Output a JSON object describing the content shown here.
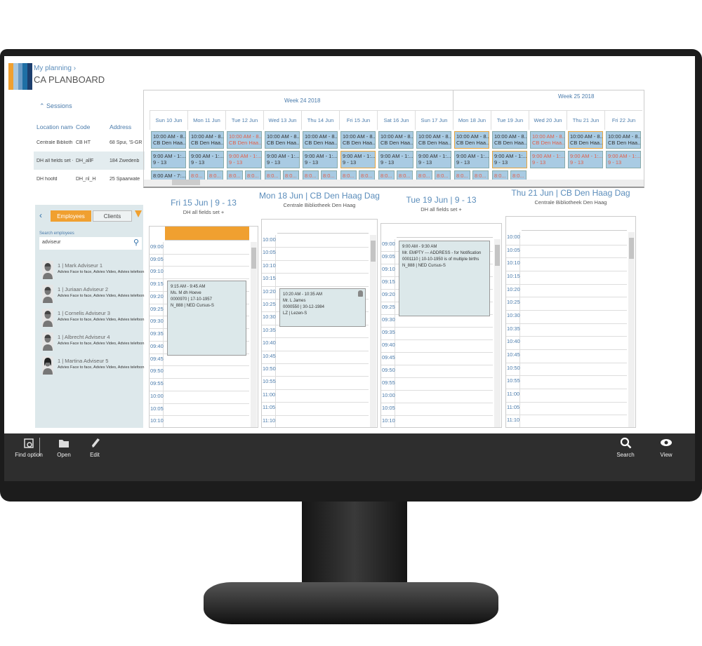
{
  "header": {
    "breadcrumb": "My planning",
    "title": "CA PLANBOARD",
    "logo_colors": [
      "#f0a030",
      "#a9c7de",
      "#6a9bc6",
      "#1f6fa5",
      "#1d3f6e"
    ]
  },
  "sessions": {
    "label": "Sessions",
    "columns": [
      "Location name",
      "Code",
      "Address"
    ],
    "rows": [
      [
        "Centrale Biblioth...",
        "CB HT",
        "68 Spui, 'S-GR"
      ],
      [
        "DH all fields set +",
        "DH_allF",
        "184 Zwedenb"
      ],
      [
        "DH hoofd",
        "DH_nl_H",
        "25 Spaarwate"
      ]
    ]
  },
  "planboard": {
    "weeks": [
      "Week 24 2018",
      "Week 25 2018"
    ],
    "days": [
      {
        "label": "Sun 10 Jun",
        "r1": {
          "t": [
            "10:00 AM - 8...",
            "CB Den Haa..."
          ]
        },
        "r2": {
          "t": [
            "9:00 AM - 1:...",
            "9 - 13"
          ]
        },
        "r3": {
          "single": [
            "8:00 AM - 7:...",
            "NED | Cursus..."
          ]
        }
      },
      {
        "label": "Mon 11 Jun",
        "r1": {
          "t": [
            "10:00 AM - 8...",
            "CB Den Haa..."
          ]
        },
        "r2": {
          "t": [
            "9:00 AM - 1:...",
            "9 - 13"
          ]
        },
        "r3": {
          "pair": [
            "8:0...",
            "NE..."
          ]
        }
      },
      {
        "label": "Tue 12 Jun",
        "r1": {
          "t": [
            "10:00 AM - 8...",
            "CB Den Haa..."
          ],
          "red": true
        },
        "r2": {
          "t": [
            "9:00 AM - 1:...",
            "9 - 13"
          ],
          "red": true
        },
        "r3": {
          "pair": [
            "8:0...",
            "NE..."
          ]
        }
      },
      {
        "label": "Wed 13 Jun",
        "r1": {
          "t": [
            "10:00 AM - 8...",
            "CB Den Haa..."
          ]
        },
        "r2": {
          "t": [
            "9:00 AM - 1:...",
            "9 - 13"
          ]
        },
        "r3": {
          "pair": [
            "8:0...",
            "NE..."
          ]
        }
      },
      {
        "label": "Thu 14 Jun",
        "r1": {
          "t": [
            "10:00 AM - 8...",
            "CB Den Haa..."
          ]
        },
        "r2": {
          "t": [
            "9:00 AM - 1:...",
            "9 - 13"
          ]
        },
        "r3": {
          "pair": [
            "8:0...",
            "NE..."
          ]
        }
      },
      {
        "label": "Fri 15 Jun",
        "r1": {
          "t": [
            "10:00 AM - 8...",
            "CB Den Haa..."
          ]
        },
        "r2": {
          "t": [
            "9:00 AM - 1:...",
            "9 - 13"
          ],
          "sel": true
        },
        "r3": {
          "pair": [
            "8:0...",
            "NE..."
          ]
        }
      },
      {
        "label": "Sat 16 Jun",
        "r1": {
          "t": [
            "10:00 AM - 8...",
            "CB Den Haa..."
          ]
        },
        "r2": {
          "t": [
            "9:00 AM - 1:...",
            "9 - 13"
          ]
        },
        "r3": {
          "pair": [
            "8:0...",
            "NE..."
          ]
        }
      },
      {
        "label": "Sun 17 Jun",
        "r1": {
          "t": [
            "10:00 AM - 8...",
            "CB Den Haa..."
          ]
        },
        "r2": {
          "t": [
            "9:00 AM - 1:...",
            "9 - 13"
          ]
        },
        "r3": {
          "pair": [
            "8:0...",
            "NE..."
          ]
        }
      },
      {
        "label": "Mon 18 Jun",
        "r1": {
          "t": [
            "10:00 AM - 8...",
            "CB Den Haa..."
          ],
          "sel": true
        },
        "r2": {
          "t": [
            "9:00 AM - 1:...",
            "9 - 13"
          ]
        },
        "r3": {
          "pair": [
            "8:0...",
            "NE..."
          ]
        }
      },
      {
        "label": "Tue 19 Jun",
        "r1": {
          "t": [
            "10:00 AM - 8...",
            "CB Den Haa..."
          ]
        },
        "r2": {
          "t": [
            "9:00 AM - 1:...",
            "9 - 13"
          ],
          "sel": true
        },
        "r3": {
          "pair": [
            "8:0...",
            "NE..."
          ]
        }
      },
      {
        "label": "Wed 20 Jun",
        "r1": {
          "t": [
            "10:00 AM - 8...",
            "CB Den Haa..."
          ],
          "red": true
        },
        "r2": {
          "t": [
            "9:00 AM - 1:...",
            "9 - 13"
          ],
          "red": true
        }
      },
      {
        "label": "Thu 21 Jun",
        "r1": {
          "t": [
            "10:00 AM - 8...",
            "CB Den Haa..."
          ],
          "sel": true
        },
        "r2": {
          "t": [
            "9:00 AM - 1:...",
            "9 - 13"
          ],
          "red": true
        }
      },
      {
        "label": "Fri 22 Jun",
        "r1": {
          "t": [
            "10:00 AM - 8...",
            "CB Den Haa..."
          ]
        },
        "r2": {
          "t": [
            "9:00 AM - 1:...",
            "9 - 13"
          ],
          "red": true
        }
      }
    ]
  },
  "panel": {
    "tabs": [
      "Employees",
      "Clients"
    ],
    "active_tab": "Employees",
    "search_label": "Search employees",
    "search_value": "adviseur",
    "employees": [
      {
        "name": "1 | Mark Adviseur 1",
        "skills": "Advies Face to face, Advies Video, Advies telefoon",
        "gender": "m"
      },
      {
        "name": "1 | Juriaan Adviseur 2",
        "skills": "Advies Face to face, Advies Video, Advies telefoon",
        "gender": "m"
      },
      {
        "name": "1 | Cornelis Adviseur 3",
        "skills": "Advies Face to face, Advies Video, Advies telefoon",
        "gender": "m"
      },
      {
        "name": "1 | Albrecht Adviseur 4",
        "skills": "Advies Face to face, Advies Video, Advies telefoon",
        "gender": "m"
      },
      {
        "name": "1 | Martina Adviseur 5",
        "skills": "Advies Face to face, Advies Video, Advies telefoon",
        "gender": "f"
      }
    ]
  },
  "calendars": [
    {
      "title": "Fri 15 Jun | 9 - 13",
      "subtitle": "DH all fields set +",
      "header_color": "#f0a030",
      "times": [
        "09:00",
        "09:05",
        "09:10",
        "09:15",
        "09:20",
        "09:25",
        "09:30",
        "09:35",
        "09:40",
        "09:45",
        "09:50",
        "09:55",
        "10:00",
        "10:05",
        "10:10"
      ],
      "event": {
        "start": 3,
        "span": 6,
        "lines": [
          "9:15 AM - 9:45 AM",
          "Ms. M dh Hoeve",
          "0000970 | 17-10-1957",
          "N_888 | NED Cursus-S"
        ]
      }
    },
    {
      "title": "Mon 18 Jun | CB Den Haag Dag",
      "subtitle": "Centrale Bibliotheek Den Haag",
      "times": [
        "10:00",
        "10:05",
        "10:10",
        "10:15",
        "10:20",
        "10:25",
        "10:30",
        "10:35",
        "10:40",
        "10:45",
        "10:50",
        "10:55",
        "11:00",
        "11:05",
        "11:10"
      ],
      "event": {
        "start": 4,
        "span": 3,
        "person_icon": true,
        "lines": [
          "10:20 AM - 10:35 AM",
          "Mr. L James",
          "0000550 | 30-12-1984",
          "LZ | Lezen-S"
        ]
      }
    },
    {
      "title": "Tue 19 Jun | 9 - 13",
      "subtitle": "DH all fields set +",
      "times": [
        "09:00",
        "09:05",
        "09:10",
        "09:15",
        "09:20",
        "09:25",
        "09:30",
        "09:35",
        "09:40",
        "09:45",
        "09:50",
        "09:55",
        "10:00",
        "10:05",
        "10:10"
      ],
      "event": {
        "start": 0,
        "span": 6,
        "lines": [
          "9:00 AM - 9:30 AM",
          "Mr. EMPTY --- ADDRESS - for Notification",
          "0001110 | 10-10-1950 is of multiple births",
          "N_888 | NED Cursus-S"
        ]
      }
    },
    {
      "title": "Thu 21 Jun | CB Den Haag Dag",
      "subtitle": "Centrale Bibliotheek Den Haag",
      "times": [
        "10:00",
        "10:05",
        "10:10",
        "10:15",
        "10:20",
        "10:25",
        "10:30",
        "10:35",
        "10:40",
        "10:45",
        "10:50",
        "10:55",
        "11:00",
        "11:05",
        "11:10"
      ]
    }
  ],
  "toolbar": {
    "left": [
      {
        "label": "Find option",
        "icon": "calendar-search-icon"
      },
      {
        "label": "Open",
        "icon": "folder-open-icon"
      },
      {
        "label": "Edit",
        "icon": "pencil-icon"
      }
    ],
    "right": [
      {
        "label": "Search",
        "icon": "search-icon"
      },
      {
        "label": "View",
        "icon": "eye-icon"
      }
    ]
  },
  "colors": {
    "accent": "#f0a030",
    "cell": "#a9cbe3",
    "link": "#4a7bab",
    "alert_text": "#e0604a"
  }
}
